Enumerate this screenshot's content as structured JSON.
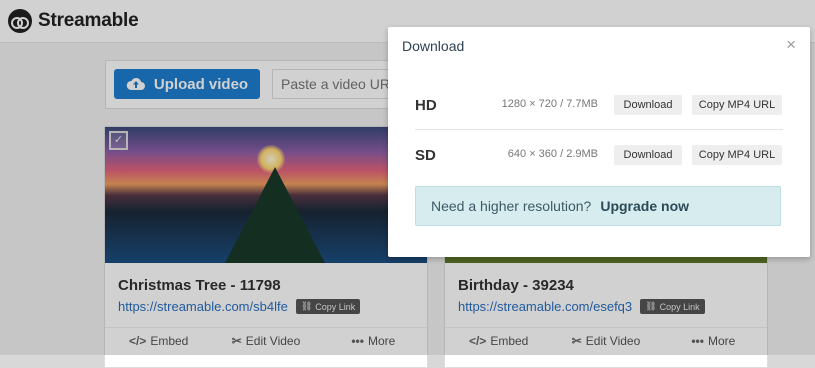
{
  "app": {
    "name": "Streamable"
  },
  "upload": {
    "button_label": "Upload video",
    "paste_placeholder": "Paste a video URL"
  },
  "cards": [
    {
      "title": "Christmas Tree - 11798",
      "link": "https://streamable.com/sb4lfe",
      "copy_link_label": "Copy Link",
      "actions": [
        {
          "icon": "code-icon",
          "label": "Embed"
        },
        {
          "icon": "scissors-icon",
          "label": "Edit Video"
        },
        {
          "icon": "ellipsis-icon",
          "label": "More"
        }
      ]
    },
    {
      "title": "Birthday - 39234",
      "link": "https://streamable.com/esefq3",
      "copy_link_label": "Copy Link",
      "actions": [
        {
          "icon": "code-icon",
          "label": "Embed"
        },
        {
          "icon": "scissors-icon",
          "label": "Edit Video"
        },
        {
          "icon": "ellipsis-icon",
          "label": "More"
        }
      ]
    }
  ],
  "modal": {
    "title": "Download",
    "close_glyph": "×",
    "options": [
      {
        "quality": "HD",
        "info": "1280 × 720 / 7.7MB",
        "download_label": "Download",
        "copy_label": "Copy MP4 URL"
      },
      {
        "quality": "SD",
        "info": "640 × 360 / 2.9MB",
        "download_label": "Download",
        "copy_label": "Copy MP4 URL"
      }
    ],
    "upgrade_text": "Need a higher resolution?",
    "upgrade_link": "Upgrade now"
  },
  "colors": {
    "primary": "#1e7ed0",
    "upgrade_bg": "#d6ecef",
    "link": "#2a6fc0"
  }
}
